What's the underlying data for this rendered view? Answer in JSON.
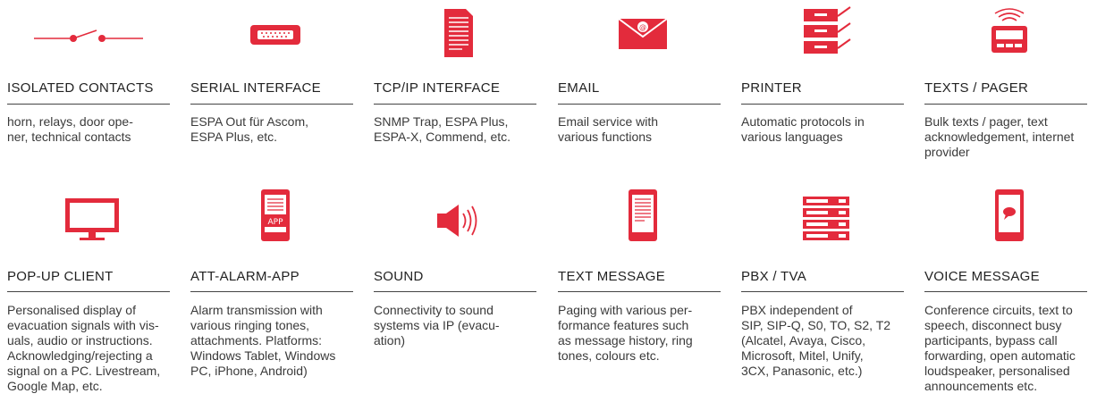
{
  "row1": [
    {
      "title": "ISOLATED CONTACTS",
      "desc": "horn, relays, door ope-\nner, technical contacts",
      "icon": "switch-icon"
    },
    {
      "title": "SERIAL INTERFACE",
      "desc": "ESPA Out für Ascom,\nESPA Plus, etc.",
      "icon": "serial-port-icon"
    },
    {
      "title": "TCP/IP INTERFACE",
      "desc": "SNMP Trap, ESPA Plus,\nESPA-X, Commend, etc.",
      "icon": "document-icon"
    },
    {
      "title": "EMAIL",
      "desc": "Email service with\nvarious functions",
      "icon": "envelope-icon"
    },
    {
      "title": "PRINTER",
      "desc": "Automatic protocols in\nvarious languages",
      "icon": "printer-icon"
    },
    {
      "title": "TEXTS / PAGER",
      "desc": "Bulk texts / pager, text\nacknowledgement, internet\nprovider",
      "icon": "pager-icon"
    }
  ],
  "row2": [
    {
      "title": "POP-UP CLIENT",
      "desc": "Personalised display of\nevacuation signals with vis-\nuals, audio or instructions.\nAcknowledging/rejecting a\nsignal on a PC. Livestream,\nGoogle Map, etc.",
      "icon": "monitor-icon"
    },
    {
      "title": "ATT-ALARM-APP",
      "desc": "Alarm transmission with\nvarious ringing tones,\nattachments. Platforms:\nWindows Tablet, Windows\nPC, iPhone, Android)",
      "icon": "phone-app-icon",
      "app_label": "APP"
    },
    {
      "title": "SOUND",
      "desc": "Connectivity to sound\nsystems via IP (evacu-\nation)",
      "icon": "speaker-icon"
    },
    {
      "title": "TEXT MESSAGE",
      "desc": "Paging with various per-\nformance features such\nas message history, ring\ntones, colours etc.",
      "icon": "phone-text-icon"
    },
    {
      "title": "PBX / TVA",
      "desc": "PBX independent of\nSIP, SIP-Q, S0, TO, S2, T2\n(Alcatel, Avaya, Cisco,\nMicrosoft, Mitel, Unify,\n3CX, Panasonic, etc.)",
      "icon": "server-rack-icon"
    },
    {
      "title": "VOICE MESSAGE",
      "desc": "Conference circuits, text to\nspeech, disconnect busy\nparticipants, bypass call\nforwarding, open automatic\nloudspeaker, personalised\nannouncements etc.",
      "icon": "phone-voice-icon"
    }
  ],
  "colors": {
    "accent": "#e32b3c",
    "text": "#333333",
    "rule": "#444444"
  }
}
